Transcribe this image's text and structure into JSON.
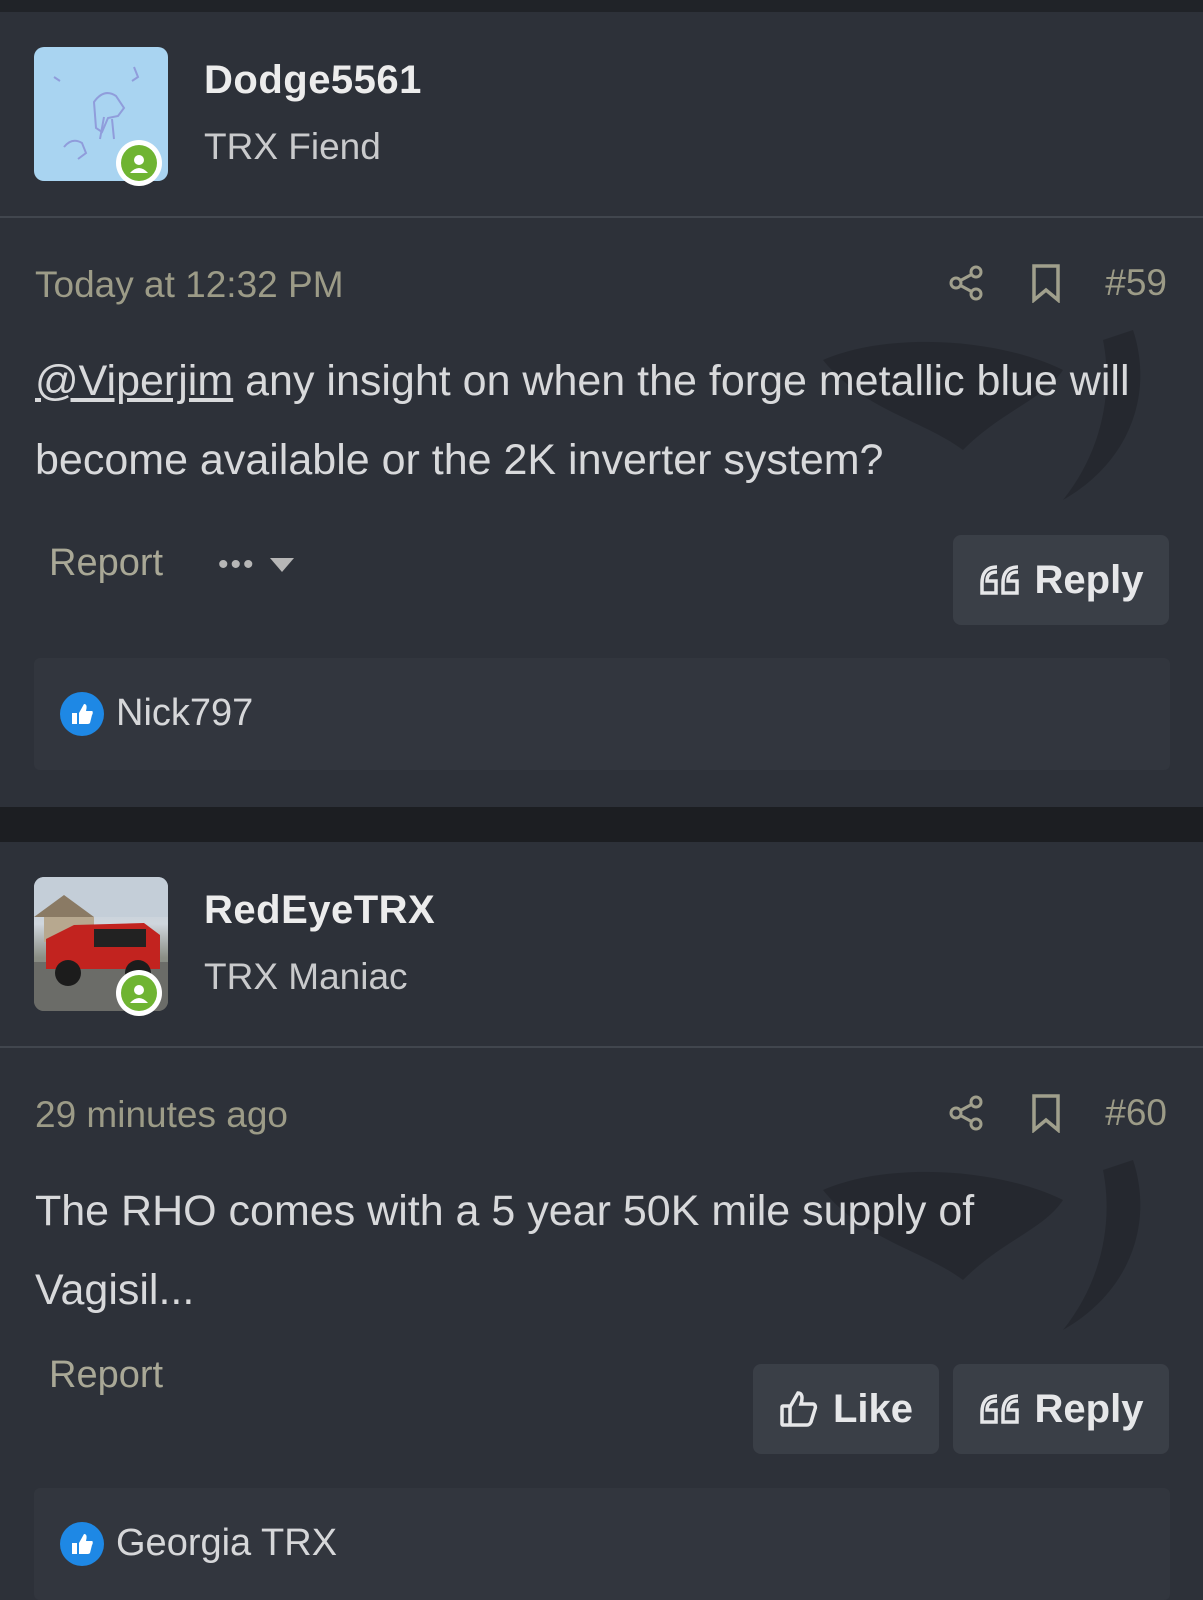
{
  "posts": [
    {
      "username": "Dodge5561",
      "user_title": "TRX Fiend",
      "time": "Today at 12:32 PM",
      "post_number": "#59",
      "mention": "@Viperjim",
      "body": " any insight on when the forge metallic blue will become available or the 2K inverter system?",
      "report_label": "Report",
      "more_label": "•••",
      "reply_label": "Reply",
      "liked_by": "Nick797"
    },
    {
      "username": "RedEyeTRX",
      "user_title": "TRX Maniac",
      "time": "29 minutes ago",
      "post_number": "#60",
      "body": "The RHO comes with a 5 year 50K mile supply of Vagisil...",
      "report_label": "Report",
      "like_label": "Like",
      "reply_label": "Reply",
      "liked_by": "Georgia TRX"
    }
  ],
  "colors": {
    "background": "#2d3139",
    "separator": "#1c1e22",
    "meta_text": "#9c9b87",
    "online": "#6fb432",
    "like_badge": "#1e88e5",
    "button": "#3a3f47"
  },
  "icons": [
    "share-icon",
    "bookmark-icon",
    "quote-icon",
    "thumbs-up-icon",
    "online-status-icon",
    "dropdown-caret-icon"
  ]
}
